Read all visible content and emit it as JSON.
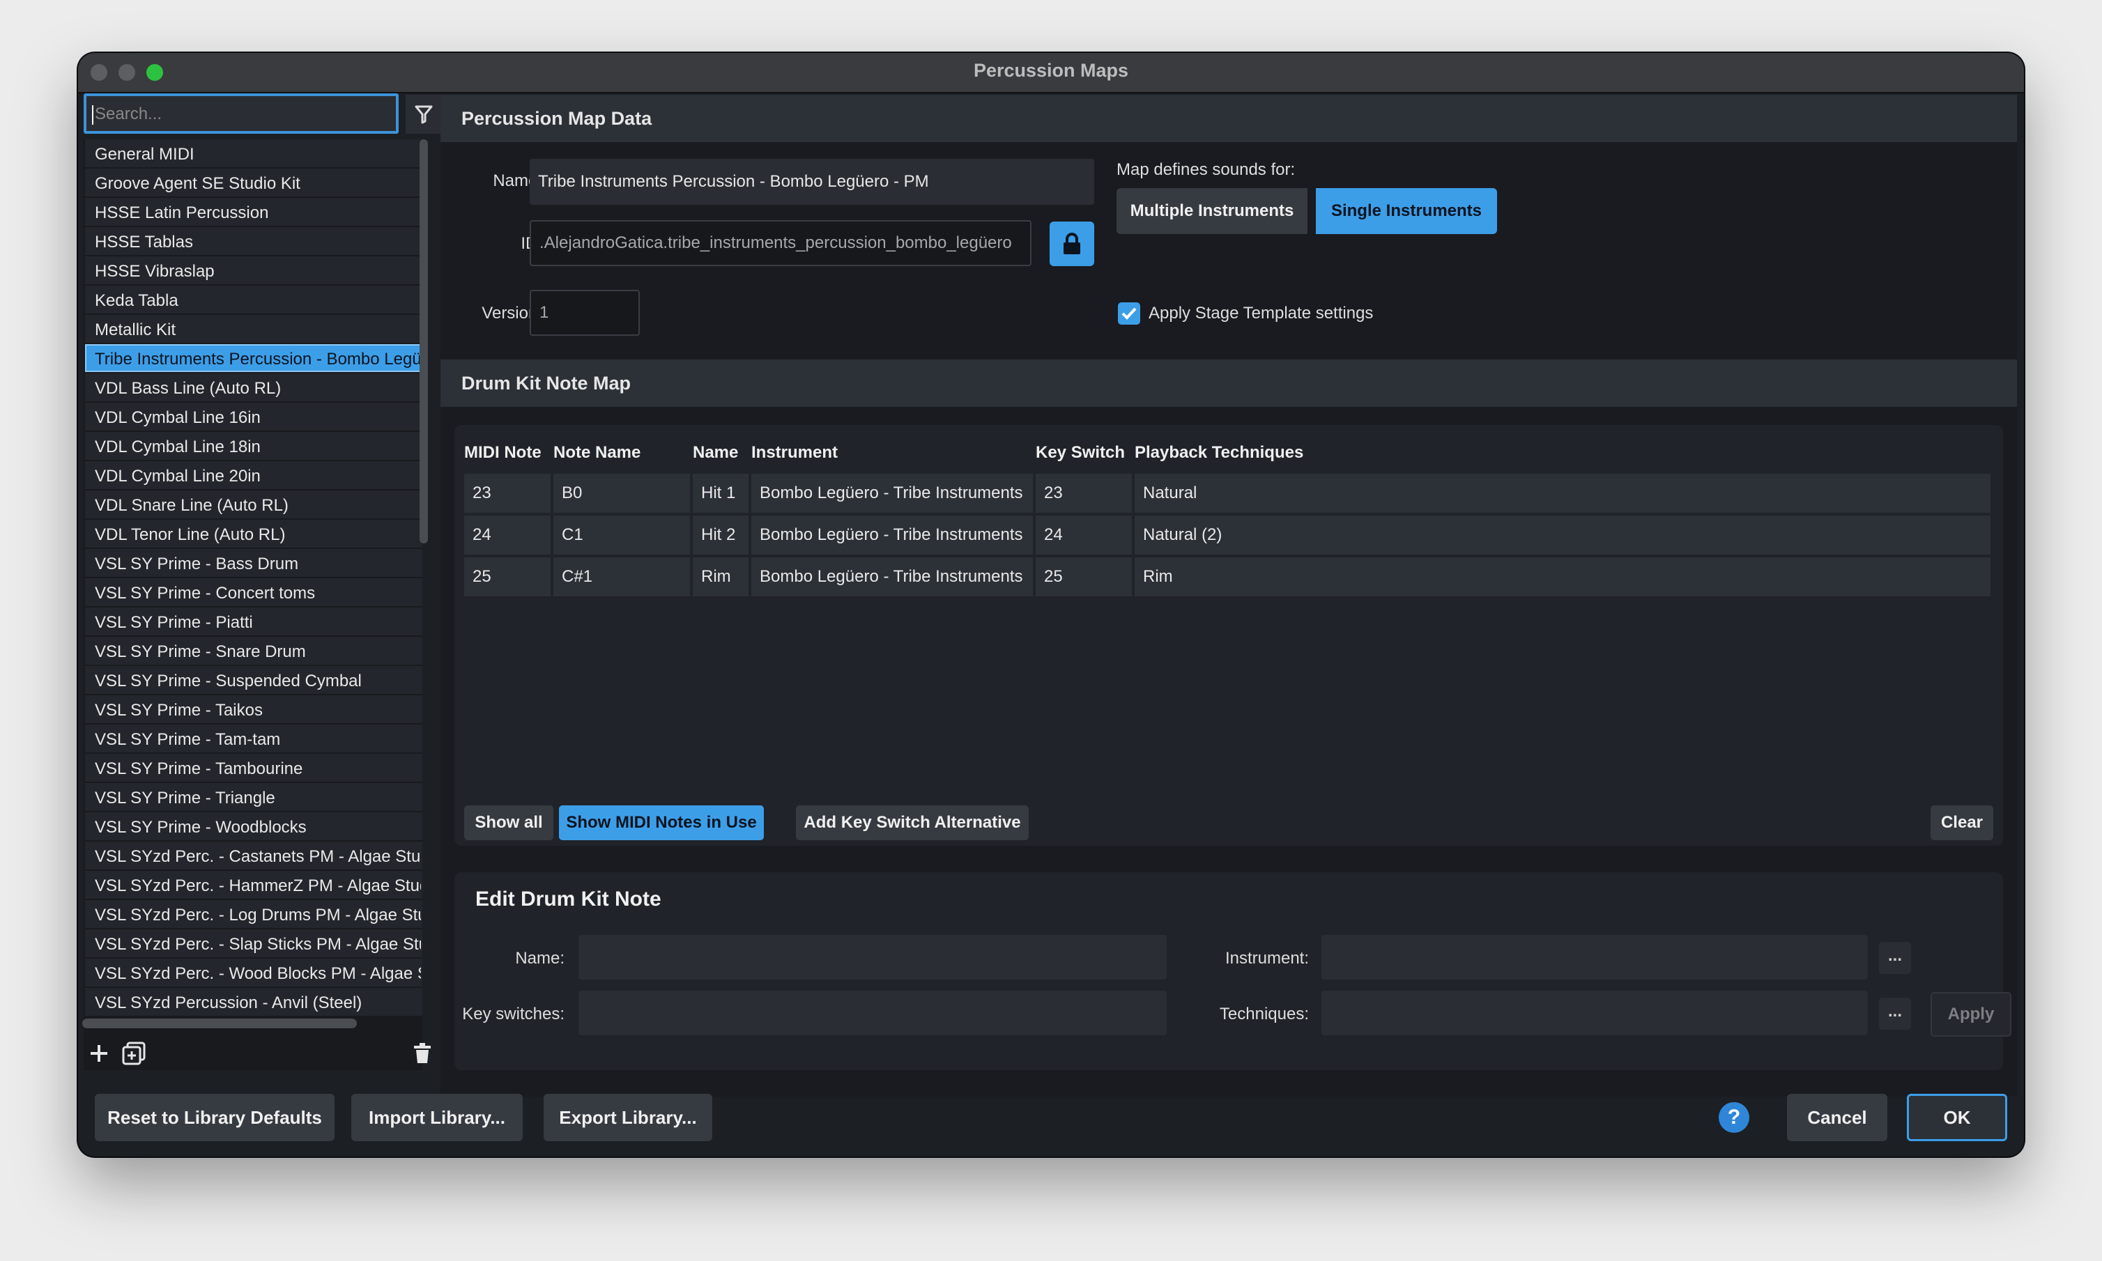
{
  "window": {
    "title": "Percussion Maps"
  },
  "sidebar": {
    "search_placeholder": "Search...",
    "items": [
      "General MIDI",
      "Groove Agent SE Studio Kit",
      "HSSE Latin Percussion",
      "HSSE Tablas",
      "HSSE Vibraslap",
      "Keda Tabla",
      "Metallic Kit",
      "Tribe Instruments Percussion - Bombo Legüero - PM",
      "VDL Bass Line (Auto RL)",
      "VDL Cymbal Line 16in",
      "VDL Cymbal Line 18in",
      "VDL Cymbal Line 20in",
      "VDL Snare Line (Auto RL)",
      "VDL Tenor Line (Auto RL)",
      "VSL SY Prime - Bass Drum",
      "VSL SY Prime - Concert toms",
      "VSL SY Prime - Piatti",
      "VSL SY Prime - Snare Drum",
      "VSL SY Prime - Suspended Cymbal",
      "VSL SY Prime - Taikos",
      "VSL SY Prime - Tam-tam",
      "VSL SY Prime - Tambourine",
      "VSL SY Prime - Triangle",
      "VSL SY Prime - Woodblocks",
      "VSL SYzd Perc. - Castanets PM - Algae Studio",
      "VSL SYzd Perc. - HammerZ PM - Algae Studio",
      "VSL SYzd Perc. - Log Drums PM - Algae Studio",
      "VSL SYzd Perc. - Slap Sticks PM - Algae Studio",
      "VSL SYzd Perc. - Wood Blocks PM - Algae Studio",
      "VSL SYzd Percussion - Anvil (Steel)"
    ],
    "selected_index": 7
  },
  "map_data": {
    "header": "Percussion Map Data",
    "name_label": "Name:",
    "name_value": "Tribe Instruments Percussion - Bombo Legüero - PM",
    "id_label": "ID:",
    "id_value": ".AlejandroGatica.tribe_instruments_percussion_bombo_legüero",
    "version_label": "Version:",
    "version_value": "1",
    "sounds_for_label": "Map defines sounds for:",
    "multiple_label": "Multiple Instruments",
    "single_label": "Single Instruments",
    "selected_mode": "Single Instruments",
    "apply_stage_label": "Apply Stage Template settings",
    "apply_stage_checked": true
  },
  "drum_map": {
    "header": "Drum Kit Note Map",
    "columns": [
      "MIDI Note",
      "Note Name",
      "Name",
      "Instrument",
      "Key Switch",
      "Playback Techniques"
    ],
    "rows": [
      [
        "23",
        "B0",
        "Hit 1",
        "Bombo Legüero - Tribe Instruments",
        "23",
        "Natural"
      ],
      [
        "24",
        "C1",
        "Hit 2",
        "Bombo Legüero - Tribe Instruments",
        "24",
        "Natural (2)"
      ],
      [
        "25",
        "C#1",
        "Rim",
        "Bombo Legüero - Tribe Instruments",
        "25",
        "Rim"
      ]
    ],
    "show_all_label": "Show all",
    "show_midi_label": "Show MIDI Notes in Use",
    "add_key_switch_label": "Add Key Switch Alternative",
    "clear_label": "Clear"
  },
  "edit_note": {
    "title": "Edit Drum Kit Note",
    "name_label": "Name:",
    "instrument_label": "Instrument:",
    "key_switches_label": "Key switches:",
    "techniques_label": "Techniques:",
    "dots_label": "...",
    "apply_label": "Apply"
  },
  "footer": {
    "reset_label": "Reset to Library Defaults",
    "import_label": "Import Library...",
    "export_label": "Export Library...",
    "help_label": "?",
    "cancel_label": "Cancel",
    "ok_label": "OK"
  },
  "colors": {
    "accent": "#3d9ee8",
    "background": "#1c1f24",
    "panel_header": "#2c3037"
  }
}
